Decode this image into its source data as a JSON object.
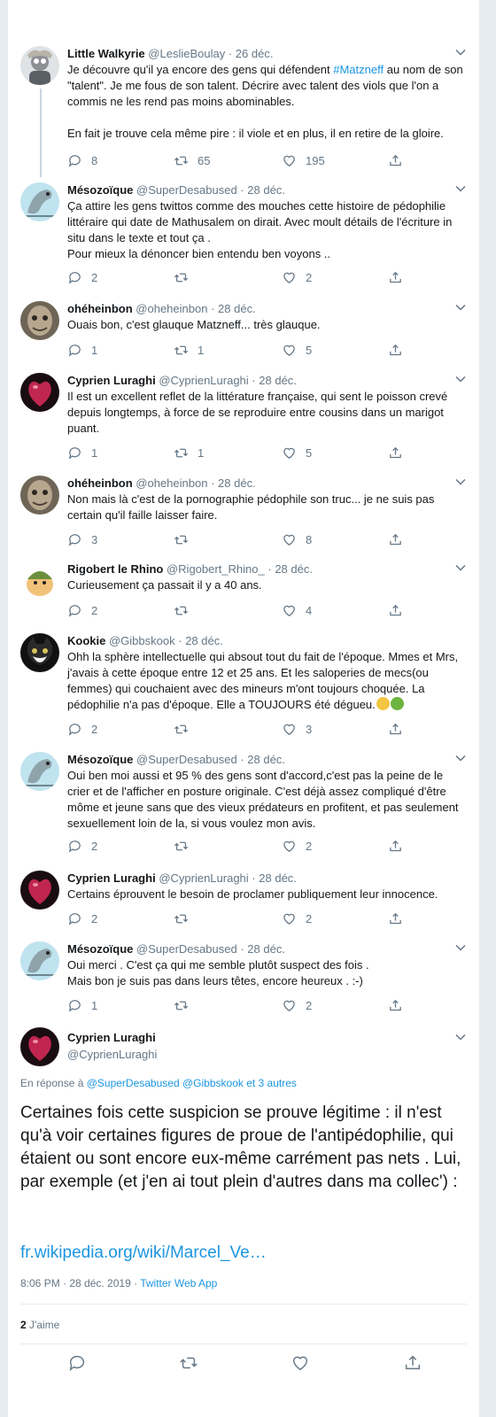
{
  "tweets": [
    {
      "name": "Little Walkyrie",
      "handle": "@LeslieBoulay",
      "date": "26 déc.",
      "avatar": "avatar-walkyrie",
      "text_before_tag": "Je découvre qu'il ya encore des gens qui défendent ",
      "hashtag": "#Matzneff",
      "text_after_tag": " au nom de son \"talent\". Je me fous de son talent. Décrire avec talent des viols que l'on a commis ne les rend pas moins abominables.",
      "text2": "En fait je trouve cela même pire : il viole et en plus, il en retire de la gloire.",
      "replies": "8",
      "retweets": "65",
      "likes": "195"
    },
    {
      "name": "Mésozoïque",
      "handle": "@SuperDesabused",
      "date": "28 déc.",
      "avatar": "avatar-mesozoique",
      "line1": "Ça attire les gens twittos  comme des mouches cette histoire de pédophilie littéraire qui date de Mathusalem on dirait. Avec moult détails de l'écriture in situ dans le texte et tout ça .",
      "line2": "Pour mieux la dénoncer bien entendu ben voyons ..",
      "replies": "2",
      "retweets": "",
      "likes": "2"
    },
    {
      "name": "ohéheinbon",
      "handle": "@oheheinbon",
      "date": "28 déc.",
      "avatar": "avatar-oheheinbon",
      "text": "Ouais bon, c'est glauque Matzneff... très glauque.",
      "replies": "1",
      "retweets": "1",
      "likes": "5"
    },
    {
      "name": "Cyprien Luraghi",
      "handle": "@CyprienLuraghi",
      "date": "28 déc.",
      "avatar": "avatar-cyprien",
      "text": "Il est un excellent reflet de la littérature française, qui sent le poisson crevé depuis longtemps, à force de se reproduire entre cousins dans un marigot puant.",
      "replies": "1",
      "retweets": "1",
      "likes": "5"
    },
    {
      "name": "ohéheinbon",
      "handle": "@oheheinbon",
      "date": "28 déc.",
      "avatar": "avatar-oheheinbon",
      "text": "Non mais là c'est de la pornographie pédophile son truc... je ne suis pas certain qu'il faille laisser faire.",
      "replies": "3",
      "retweets": "",
      "likes": "8"
    },
    {
      "name": "Rigobert le Rhino",
      "handle": "@Rigobert_Rhino_",
      "date": "28 déc.",
      "avatar": "avatar-rigobert",
      "text": "Curieusement ça passait il y a 40 ans.",
      "replies": "2",
      "retweets": "",
      "likes": "4"
    },
    {
      "name": "Kookie",
      "handle": "@Gibbskook",
      "date": "28 déc.",
      "avatar": "avatar-kookie",
      "text": "Ohh la sphère intellectuelle qui absout tout du fait de l'époque. Mmes et Mrs, j'avais à cette époque  entre 12 et 25 ans. Et les saloperies de mecs(ou femmes) qui couchaient avec des mineurs m'ont toujours choquée. La pédophilie n'a pas d'époque. Elle a TOUJOURS été dégueu.",
      "replies": "2",
      "retweets": "",
      "likes": "3"
    },
    {
      "name": "Mésozoïque",
      "handle": "@SuperDesabused",
      "date": "28 déc.",
      "avatar": "avatar-mesozoique",
      "text": "Oui ben moi aussi et 95 % des gens sont d'accord,c'est pas la peine de le crier et de l'afficher en posture originale. C'est déjà assez compliqué d'être môme et jeune sans que des vieux prédateurs en profitent, et pas seulement sexuellement loin de la, si vous voulez mon avis.",
      "replies": "2",
      "retweets": "",
      "likes": "2"
    },
    {
      "name": "Cyprien Luraghi",
      "handle": "@CyprienLuraghi",
      "date": "28 déc.",
      "avatar": "avatar-cyprien",
      "text": "Certains éprouvent le besoin de proclamer publiquement leur innocence.",
      "replies": "2",
      "retweets": "",
      "likes": "2"
    },
    {
      "name": "Mésozoïque",
      "handle": "@SuperDesabused",
      "date": "28 déc.",
      "avatar": "avatar-mesozoique",
      "line1": "Oui merci . C'est ça qui me semble plutôt suspect des fois .",
      "line2": "Mais bon je suis pas dans leurs têtes, encore heureux . :-)",
      "replies": "1",
      "retweets": "",
      "likes": "2"
    }
  ],
  "main": {
    "name": "Cyprien Luraghi",
    "handle": "@CyprienLuraghi",
    "avatar": "avatar-cyprien",
    "replying_prefix": "En réponse à ",
    "replying_to_1": "@SuperDesabused",
    "replying_to_2": "@Gibbskook",
    "replying_others": " et 3 autres",
    "text": "Certaines fois cette suspicion se prouve légitime : il n'est qu'à voir certaines figures de proue de l'antipédophilie, qui étaient ou sont encore eux-même carrément pas nets . Lui, par exemple (et j'en ai tout plein d'autres dans ma collec') :",
    "link": "fr.wikipedia.org/wiki/Marcel_Ve…",
    "time": "8:06 PM · 28 déc. 2019 · ",
    "app": "Twitter Web App",
    "likes_count": "2",
    "likes_label": " J'aime"
  },
  "colors": {
    "accent": "#1b95e0",
    "muted": "#657786",
    "text": "#14171a",
    "line": "#ccd6dd"
  },
  "icons": [
    "reply-icon",
    "retweet-icon",
    "like-icon",
    "share-icon",
    "chevron-down-icon"
  ]
}
